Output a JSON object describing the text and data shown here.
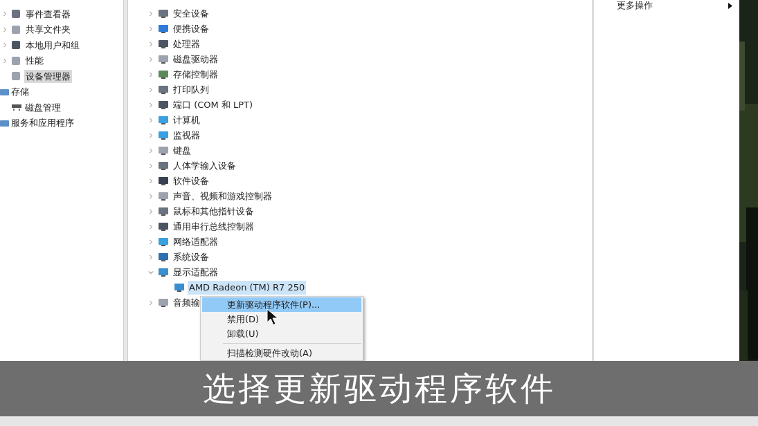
{
  "left_tree": {
    "group_children": [
      {
        "label": "事件查看器",
        "expandable": true,
        "selected": false
      },
      {
        "label": "共享文件夹",
        "expandable": true,
        "selected": false
      },
      {
        "label": "本地用户和组",
        "expandable": true,
        "selected": false
      },
      {
        "label": "性能",
        "expandable": true,
        "selected": false
      },
      {
        "label": "设备管理器",
        "expandable": false,
        "selected": true
      }
    ],
    "items": [
      {
        "label": "存储",
        "selected": false,
        "children": [
          {
            "label": "磁盘管理",
            "selected": false
          }
        ]
      },
      {
        "label": "服务和应用程序",
        "selected": false
      }
    ]
  },
  "device_tree": [
    {
      "label": "安全设备",
      "expanded": false
    },
    {
      "label": "便携设备",
      "expanded": false
    },
    {
      "label": "处理器",
      "expanded": false
    },
    {
      "label": "磁盘驱动器",
      "expanded": false
    },
    {
      "label": "存储控制器",
      "expanded": false
    },
    {
      "label": "打印队列",
      "expanded": false
    },
    {
      "label": "端口 (COM 和 LPT)",
      "expanded": false
    },
    {
      "label": "计算机",
      "expanded": false
    },
    {
      "label": "监视器",
      "expanded": false
    },
    {
      "label": "键盘",
      "expanded": false
    },
    {
      "label": "人体学输入设备",
      "expanded": false
    },
    {
      "label": "软件设备",
      "expanded": false
    },
    {
      "label": "声音、视频和游戏控制器",
      "expanded": false
    },
    {
      "label": "鼠标和其他指针设备",
      "expanded": false
    },
    {
      "label": "通用串行总线控制器",
      "expanded": false
    },
    {
      "label": "网络适配器",
      "expanded": false
    },
    {
      "label": "系统设备",
      "expanded": false
    },
    {
      "label": "显示适配器",
      "expanded": true,
      "children": [
        {
          "label": "AMD Radeon (TM) R7 250",
          "selected": true
        }
      ]
    },
    {
      "label": "音频输",
      "expanded": false
    }
  ],
  "context_menu": [
    {
      "kind": "item",
      "label": "更新驱动程序软件(P)...",
      "selected": true
    },
    {
      "kind": "item",
      "label": "禁用(D)",
      "selected": false
    },
    {
      "kind": "item",
      "label": "卸载(U)",
      "selected": false
    },
    {
      "kind": "separator"
    },
    {
      "kind": "item",
      "label": "扫描检测硬件改动(A)",
      "selected": false
    }
  ],
  "actions_pane": {
    "items": [
      {
        "label": "更多操作"
      }
    ]
  },
  "subtitle": "选择更新驱动程序软件"
}
